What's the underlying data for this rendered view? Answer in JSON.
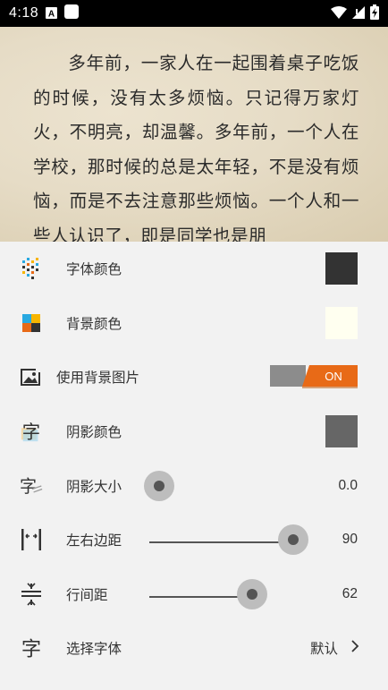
{
  "status": {
    "time": "4:18",
    "icons": [
      "a-box-icon",
      "white-square-icon",
      "wifi-icon",
      "signal-icon",
      "battery-charging-icon"
    ]
  },
  "reader": {
    "text": "多年前，一家人在一起围着桌子吃饭的时候，没有太多烦恼。只记得万家灯火，不明亮，却温馨。多年前，一个人在学校，那时候的总是太年轻，不是没有烦恼，而是不去注意那些烦恼。一个人和一些人认识了，即是同学也是朋"
  },
  "settings": {
    "font_color": {
      "label": "字体颜色",
      "color": "#333333",
      "icon": "font-color-icon"
    },
    "bg_color": {
      "label": "背景颜色",
      "color": "#fffff0",
      "icon": "background-color-icon"
    },
    "bg_image": {
      "label": "使用背景图片",
      "toggle": "ON",
      "enabled": true,
      "icon": "image-icon"
    },
    "shadow_color": {
      "label": "阴影颜色",
      "color": "#666666",
      "icon": "shadow-char-icon"
    },
    "shadow_size": {
      "label": "阴影大小",
      "value": "0.0",
      "fraction": 0.0,
      "icon": "shadow-size-icon"
    },
    "side_margin": {
      "label": "左右边距",
      "value": "90",
      "fraction": 0.9,
      "icon": "side-margin-icon"
    },
    "line_spacing": {
      "label": "行间距",
      "value": "62",
      "fraction": 0.62,
      "icon": "line-spacing-icon"
    },
    "font_select": {
      "label": "选择字体",
      "value": "默认",
      "icon": "font-select-icon"
    }
  }
}
